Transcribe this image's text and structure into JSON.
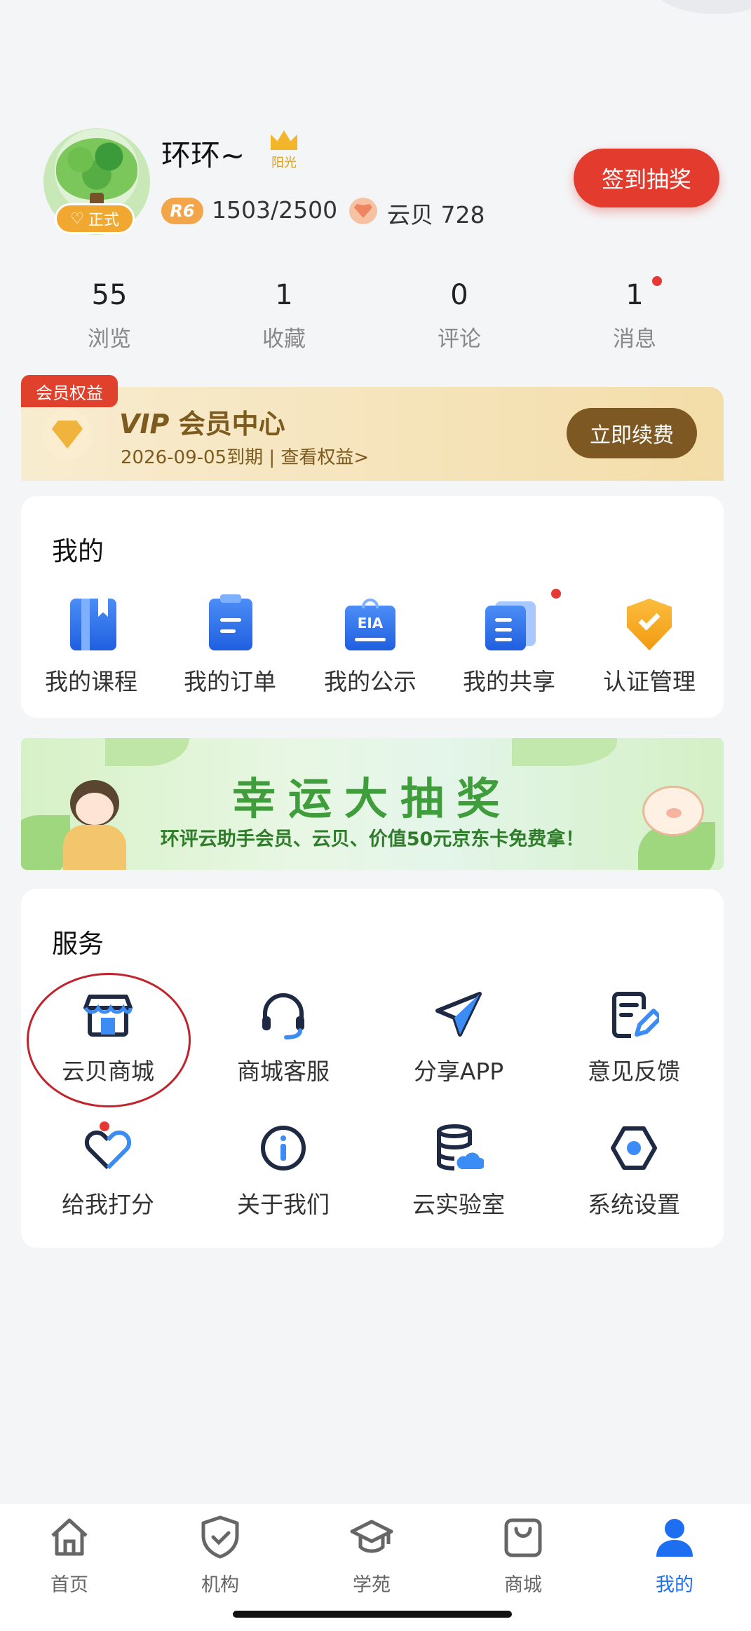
{
  "profile": {
    "username": "环环~",
    "member_badge": "正式",
    "crown_label": "阳光",
    "level_badge": "R6",
    "score": "1503/2500",
    "shell_label": "云贝 728",
    "sign_button": "签到抽奖"
  },
  "stats": [
    {
      "value": "55",
      "label": "浏览"
    },
    {
      "value": "1",
      "label": "收藏"
    },
    {
      "value": "0",
      "label": "评论"
    },
    {
      "value": "1",
      "label": "消息"
    }
  ],
  "vip": {
    "tag": "会员权益",
    "title_vip": "VIP",
    "title_rest": "会员中心",
    "subtitle": "2026-09-05到期 | 查看权益>",
    "renew_button": "立即续费"
  },
  "my": {
    "title": "我的",
    "items": [
      {
        "label": "我的课程",
        "icon": "book-icon"
      },
      {
        "label": "我的订单",
        "icon": "clipboard-icon"
      },
      {
        "label": "我的公示",
        "icon": "eia-board-icon"
      },
      {
        "label": "我的共享",
        "icon": "shared-doc-icon"
      },
      {
        "label": "认证管理",
        "icon": "shield-check-icon"
      }
    ]
  },
  "banner": {
    "title": "幸运大抽奖",
    "subtitle": "环评云助手会员、云贝、价值50元京东卡免费拿！"
  },
  "services": {
    "title": "服务",
    "items": [
      {
        "label": "云贝商城",
        "icon": "store-icon"
      },
      {
        "label": "商城客服",
        "icon": "headset-icon"
      },
      {
        "label": "分享APP",
        "icon": "paper-plane-icon"
      },
      {
        "label": "意见反馈",
        "icon": "feedback-edit-icon"
      },
      {
        "label": "给我打分",
        "icon": "heart-rating-icon"
      },
      {
        "label": "关于我们",
        "icon": "info-icon"
      },
      {
        "label": "云实验室",
        "icon": "cloud-database-icon"
      },
      {
        "label": "系统设置",
        "icon": "hexagon-settings-icon"
      }
    ]
  },
  "tabbar": [
    {
      "label": "首页",
      "icon": "home-icon"
    },
    {
      "label": "机构",
      "icon": "shield-icon"
    },
    {
      "label": "学苑",
      "icon": "graduation-cap-icon"
    },
    {
      "label": "商城",
      "icon": "shopping-bag-icon"
    },
    {
      "label": "我的",
      "icon": "user-icon"
    }
  ],
  "colors": {
    "accent_red": "#e33b2e",
    "active_tab": "#1e6ef2",
    "vip_brown": "#7e5822",
    "icon_blue": "#1f5fe0"
  }
}
